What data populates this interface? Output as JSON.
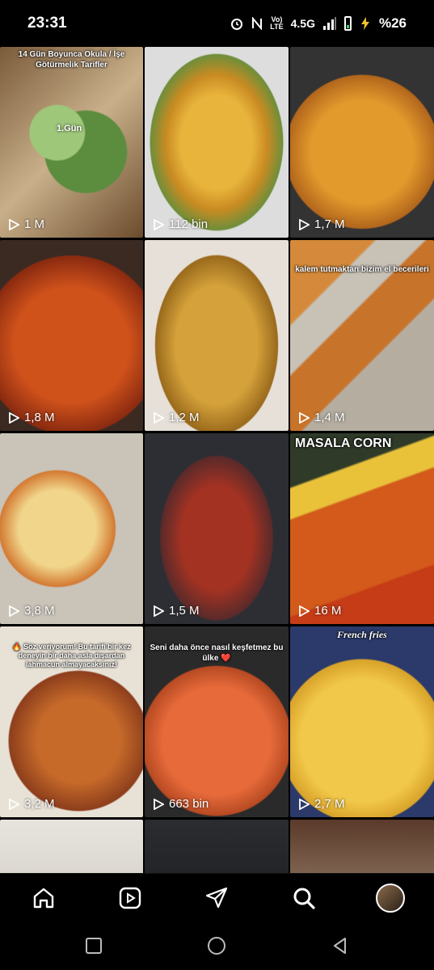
{
  "status_bar": {
    "time": "23:31",
    "network_top": "Vo)",
    "network_bottom": "LTE",
    "network_type": "4.5G",
    "battery_percent": "%26"
  },
  "tiles": [
    {
      "title": "14 Gün Boyunca Okula / İşe Götürmelik Tarifler",
      "subtitle": "1.Gün",
      "views": "1 M"
    },
    {
      "title": "",
      "subtitle": "",
      "views": "112 bin"
    },
    {
      "title": "",
      "subtitle": "",
      "views": "1,7 M"
    },
    {
      "title": "",
      "subtitle": "",
      "views": "1,8 M"
    },
    {
      "title": "",
      "subtitle": "",
      "views": "1,2 M"
    },
    {
      "title": "kalem tutmaktan bizim el becerileri",
      "subtitle": "",
      "views": "1,4 M"
    },
    {
      "title": "",
      "subtitle": "",
      "views": "3,8 M"
    },
    {
      "title": "",
      "subtitle": "",
      "views": "1,5 M"
    },
    {
      "title": "MASALA CORN",
      "subtitle": "",
      "views": "16 M"
    },
    {
      "title": "🔥 Söz veriyorum! Bu tarifi bir kez deneyin bir daha asla dışardan lahmacun almayacaksınız!",
      "subtitle": "",
      "views": "3,2 M"
    },
    {
      "title": "Seni daha önce nasıl keşfetmez bu ülke ❤️",
      "subtitle": "",
      "views": "663 bin"
    },
    {
      "title": "French fries",
      "subtitle": "",
      "views": "2,7 M"
    },
    {
      "title": "",
      "subtitle": "",
      "views": ""
    },
    {
      "title": "",
      "subtitle": "",
      "views": ""
    },
    {
      "title": "",
      "subtitle": "",
      "views": ""
    }
  ],
  "nav": {
    "items": [
      "home-icon",
      "reels-icon",
      "send-icon",
      "search-icon",
      "profile-avatar"
    ]
  },
  "system_nav": [
    "recents-square-icon",
    "home-circle-icon",
    "back-triangle-icon"
  ]
}
